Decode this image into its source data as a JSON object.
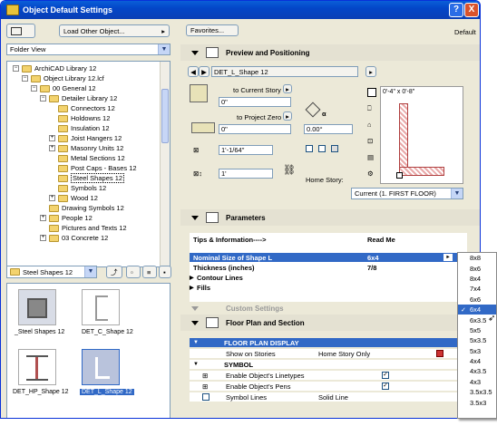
{
  "window": {
    "title": "Object Default Settings",
    "help_label": "?",
    "close_label": "X"
  },
  "left": {
    "load_button": "Load Other Object...",
    "folder_view": "Folder View",
    "tree": [
      {
        "label": "ArchiCAD Library 12"
      },
      {
        "label": "Object Library 12.lcf"
      },
      {
        "label": "00 General 12"
      },
      {
        "label": "Detailer Library 12"
      },
      {
        "label": "Connectors 12"
      },
      {
        "label": "Holdowns 12"
      },
      {
        "label": "Insulation 12"
      },
      {
        "label": "Joist Hangers 12"
      },
      {
        "label": "Masonry Units 12"
      },
      {
        "label": "Metal Sections 12"
      },
      {
        "label": "Post Caps - Bases 12"
      },
      {
        "label": "Steel Shapes 12"
      },
      {
        "label": "Symbols 12"
      },
      {
        "label": "Wood 12"
      },
      {
        "label": "Drawing Symbols 12"
      },
      {
        "label": "People 12"
      },
      {
        "label": "Pictures and Texts 12"
      },
      {
        "label": "03 Concrete 12"
      }
    ],
    "current_folder": "Steel Shapes 12",
    "thumbs": [
      {
        "label": "_Steel Shapes 12"
      },
      {
        "label": "DET_C_Shape 12"
      },
      {
        "label": "DET_HP_Shape 12"
      },
      {
        "label": "DET_L_Shape 12"
      }
    ]
  },
  "right": {
    "favorites_label": "Favorites...",
    "default_label": "Default",
    "preview_title": "Preview and Positioning",
    "object_name": "DET_L_Shape 12",
    "to_current_story": "to Current Story",
    "to_project_zero": "to Project Zero",
    "elev_current": "0\"",
    "elev_project": "0\"",
    "angle": "0.00°",
    "width": "1'-1/64\"",
    "height": "1'",
    "home_story_label": "Home Story:",
    "home_story_value": "Current (1. FIRST FLOOR)",
    "preview_dims": "0'-4\" x 0'-8\"",
    "params_title": "Parameters",
    "params": [
      {
        "name": "Tips & Information---->",
        "value": "Read Me"
      },
      {
        "name": "Nominal Size of Shape L",
        "value": "6x4"
      },
      {
        "name": "Thickness (inches)",
        "value": "7/8"
      },
      {
        "name": "Contour Lines",
        "value": ""
      },
      {
        "name": "Fills",
        "value": ""
      }
    ],
    "custom_title": "Custom Settings",
    "floor_title": "Floor Plan and Section",
    "floor_display": "FLOOR PLAN DISPLAY",
    "show_on_stories": "Show on Stories",
    "home_story_only": "Home Story Only",
    "symbol_hdr": "SYMBOL",
    "linetypes": "Enable Object's Linetypes",
    "pens": "Enable Object's Pens",
    "symbol_lines": "Symbol Lines",
    "solid_line": "Solid Line"
  },
  "dropdown": [
    "8x8",
    "8x6",
    "8x4",
    "7x4",
    "6x6",
    "6x4",
    "6x3.5",
    "5x5",
    "5x3.5",
    "5x3",
    "4x4",
    "4x3.5",
    "4x3",
    "3.5x3.5",
    "3.5x3"
  ],
  "dropdown_selected": "6x4"
}
